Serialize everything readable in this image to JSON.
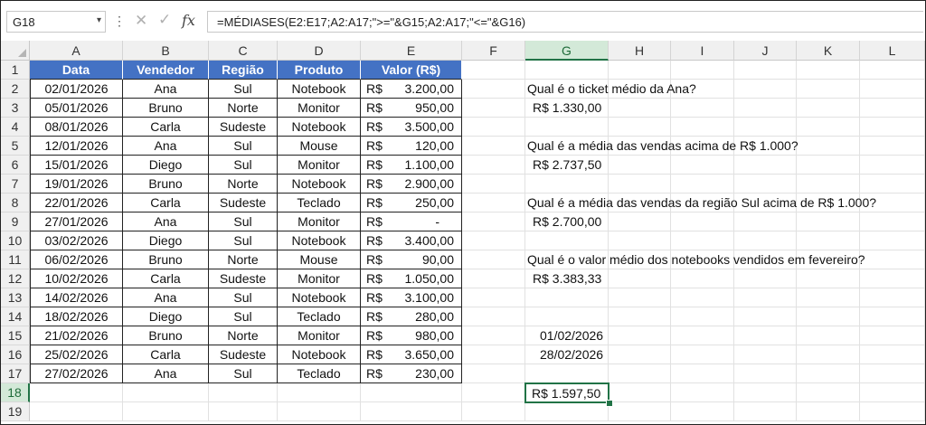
{
  "formula_bar": {
    "name_box": "G18",
    "name_box_arrow": "▾",
    "more_icon": "⋮",
    "cancel_icon": "✕",
    "enter_icon": "✓",
    "fx_label": "fx",
    "formula": "=MÉDIASES(E2:E17;A2:A17;\">=\"&G15;A2:A17;\"<=\"&G16)"
  },
  "columns": [
    "A",
    "B",
    "C",
    "D",
    "E",
    "F",
    "G",
    "H",
    "I",
    "J",
    "K",
    "L"
  ],
  "selected_column": "G",
  "rows": [
    "1",
    "2",
    "3",
    "4",
    "5",
    "6",
    "7",
    "8",
    "9",
    "10",
    "11",
    "12",
    "13",
    "14",
    "15",
    "16",
    "17",
    "18",
    "19"
  ],
  "selected_row": "18",
  "table": {
    "headers": [
      "Data",
      "Vendedor",
      "Região",
      "Produto",
      "Valor (R$)"
    ],
    "currency": "R$",
    "rows": [
      [
        "02/01/2026",
        "Ana",
        "Sul",
        "Notebook",
        "3.200,00"
      ],
      [
        "05/01/2026",
        "Bruno",
        "Norte",
        "Monitor",
        "950,00"
      ],
      [
        "08/01/2026",
        "Carla",
        "Sudeste",
        "Notebook",
        "3.500,00"
      ],
      [
        "12/01/2026",
        "Ana",
        "Sul",
        "Mouse",
        "120,00"
      ],
      [
        "15/01/2026",
        "Diego",
        "Sul",
        "Monitor",
        "1.100,00"
      ],
      [
        "19/01/2026",
        "Bruno",
        "Norte",
        "Notebook",
        "2.900,00"
      ],
      [
        "22/01/2026",
        "Carla",
        "Sudeste",
        "Teclado",
        "250,00"
      ],
      [
        "27/01/2026",
        "Ana",
        "Sul",
        "Monitor",
        "-"
      ],
      [
        "03/02/2026",
        "Diego",
        "Sul",
        "Notebook",
        "3.400,00"
      ],
      [
        "06/02/2026",
        "Bruno",
        "Norte",
        "Mouse",
        "90,00"
      ],
      [
        "10/02/2026",
        "Carla",
        "Sudeste",
        "Monitor",
        "1.050,00"
      ],
      [
        "14/02/2026",
        "Ana",
        "Sul",
        "Notebook",
        "3.100,00"
      ],
      [
        "18/02/2026",
        "Diego",
        "Sul",
        "Teclado",
        "280,00"
      ],
      [
        "21/02/2026",
        "Bruno",
        "Norte",
        "Monitor",
        "980,00"
      ],
      [
        "25/02/2026",
        "Carla",
        "Sudeste",
        "Notebook",
        "3.650,00"
      ],
      [
        "27/02/2026",
        "Ana",
        "Sul",
        "Teclado",
        "230,00"
      ]
    ]
  },
  "questions": [
    {
      "q": "Qual é o ticket médio da Ana?",
      "a": "R$ 1.330,00"
    },
    {
      "q": "Qual é a média das vendas acima de R$ 1.000?",
      "a": "R$ 2.737,50"
    },
    {
      "q": "Qual é a média das vendas da região Sul acima de R$ 1.000?",
      "a": "R$ 2.700,00"
    },
    {
      "q": "Qual é o valor médio dos notebooks vendidos em fevereiro?",
      "a": "R$ 3.383,33"
    }
  ],
  "date_start": "01/02/2026",
  "date_end": "28/02/2026",
  "result": "R$ 1.597,50",
  "colors": {
    "header_fill": "#4472c4",
    "selection": "#217346"
  }
}
